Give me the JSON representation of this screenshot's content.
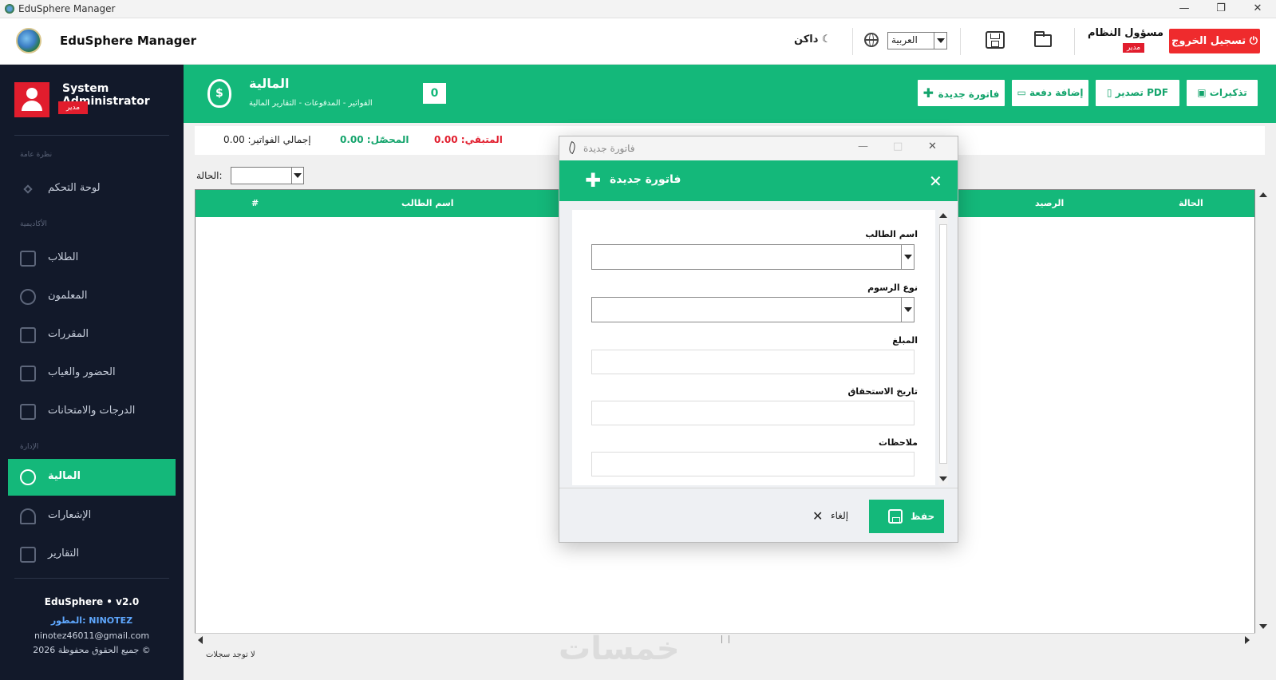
{
  "os_window": {
    "title": "EduSphere Manager",
    "minimize": "—",
    "restore": "❐",
    "close": "✕"
  },
  "header": {
    "brand": "EduSphere Manager",
    "theme_toggle": "داكن ☾",
    "language": "العربية",
    "user_name": "مسؤول النظام",
    "user_role": "مدير",
    "logout_label": "تسجيل الخروج ⏻"
  },
  "sidebar": {
    "user_name": "System Administrator",
    "user_role": "مدير",
    "sections": {
      "overview": "نظرة عامة",
      "academic": "الأكاديمية",
      "admin": "الإدارة"
    },
    "items": [
      {
        "label": "لوحة التحكم",
        "icon": "dashboard-icon"
      },
      {
        "label": "الطلاب",
        "icon": "graduation-cap-icon"
      },
      {
        "label": "المعلمون",
        "icon": "teacher-icon"
      },
      {
        "label": "المقررات",
        "icon": "books-icon"
      },
      {
        "label": "الحضور والغياب",
        "icon": "checkbox-icon"
      },
      {
        "label": "الدرجات والامتحانات",
        "icon": "clipboard-icon"
      },
      {
        "label": "المالية",
        "icon": "money-bag-icon",
        "active": true
      },
      {
        "label": "الإشعارات",
        "icon": "bell-icon"
      },
      {
        "label": "التقارير",
        "icon": "bar-chart-icon"
      }
    ],
    "footer": {
      "version": "EduSphere • v2.0",
      "developer": "المطور: NINOTEZ",
      "email": "ninotez46011@gmail.com",
      "copyright": "جميع الحقوق محفوظة 2026 ©"
    }
  },
  "finance": {
    "title": "المالية",
    "subtitle": "الفواتير - المدفوعات - التقارير المالية",
    "count": "0",
    "buttons": {
      "new_invoice": "فاتورة جديدة",
      "add_payment": "إضافة دفعة",
      "export_pdf": "تصدير PDF",
      "reminders": "تذكيرات"
    },
    "totals": {
      "remaining": "المتبقي: 0.00",
      "collected": "المحصّل: 0.00",
      "invoices_total": "إجمالي الفواتير: 0.00"
    },
    "status_label": "الحالة:",
    "table": {
      "columns": [
        "#",
        "اسم الطالب",
        "الرصيد",
        "الحالة"
      ],
      "rows": []
    },
    "empty_message": "لا توجد سجلات"
  },
  "watermark": "خمسات",
  "colors": {
    "primary": "#14b87a",
    "danger": "#ef2b2d",
    "sidebar_bg": "#12192a",
    "remaining": "#e11d2d",
    "collected": "#14a46c"
  },
  "modal": {
    "window_title": "فاتورة جديدة",
    "header_title": "فاتورة جديدة",
    "fields": {
      "student_name": "اسم الطالب",
      "fee_type": "نوع الرسوم",
      "amount": "المبلغ",
      "due_date": "تاريخ الاستحقاق",
      "notes": "ملاحظات"
    },
    "save_label": "حفظ",
    "cancel_label": "إلغاء"
  }
}
